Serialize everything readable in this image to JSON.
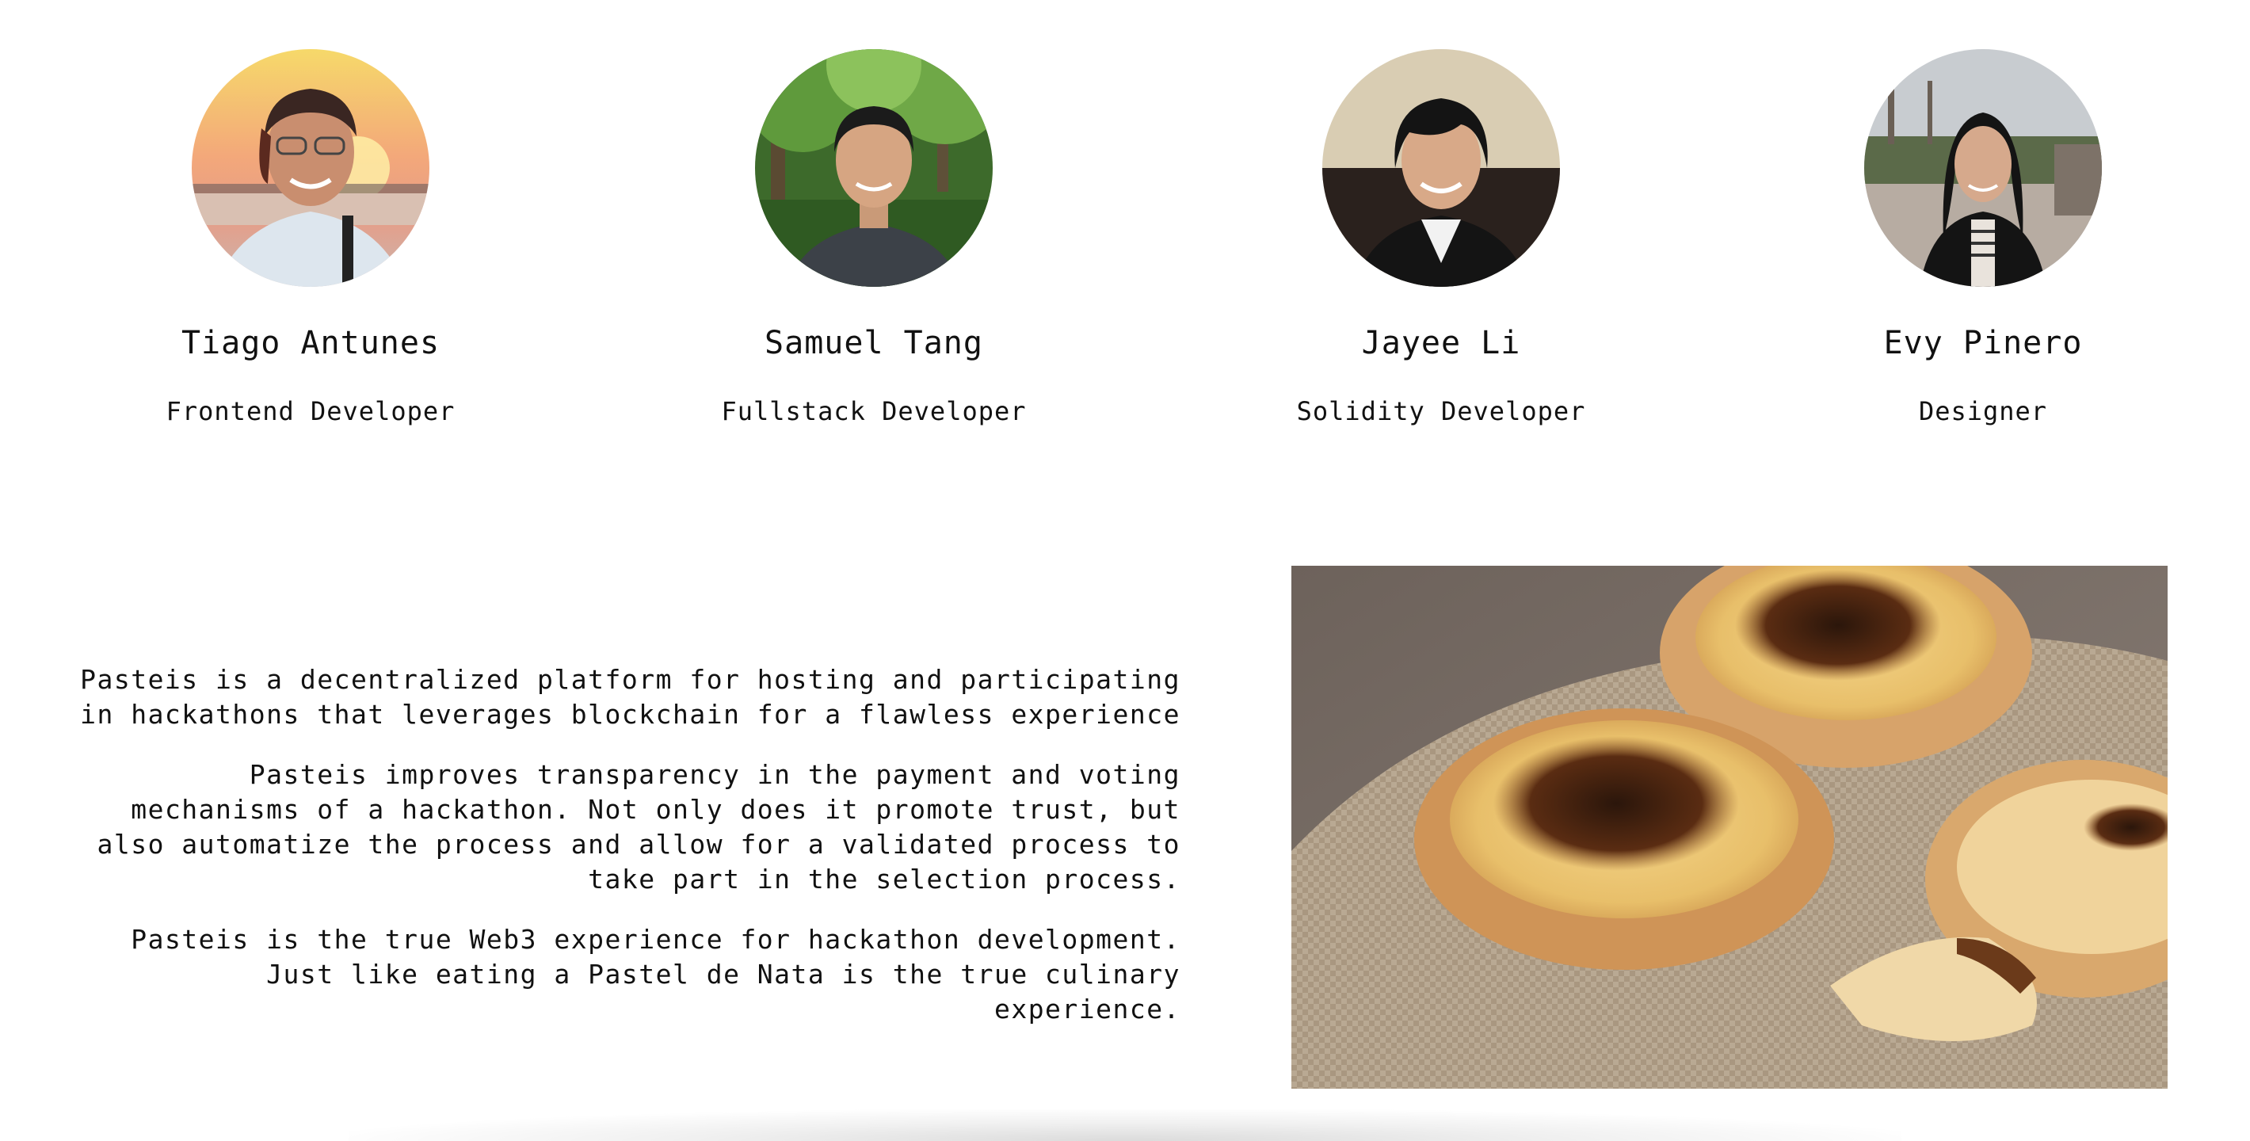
{
  "team": {
    "members": [
      {
        "name": "Tiago Antunes",
        "role": "Frontend Developer",
        "photo_icon": "portrait-sunset-photo"
      },
      {
        "name": "Samuel Tang",
        "role": "Fullstack Developer",
        "photo_icon": "portrait-forest-photo"
      },
      {
        "name": "Jayee Li",
        "role": "Solidity Developer",
        "photo_icon": "portrait-indoor-photo"
      },
      {
        "name": "Evy Pinero",
        "role": "Designer",
        "photo_icon": "portrait-park-photo"
      }
    ]
  },
  "about": {
    "paragraphs": [
      "Pasteis is a decentralized platform for hosting and participating in hackathons that leverages blockchain for a flawless experience",
      "Pasteis improves transparency in the payment and voting mechanisms of a hackathon. Not only does it promote trust, but also automatize the process and allow for a validated process to take part in the selection process.",
      "Pasteis is the true Web3 experience for hackathon development. Just like eating a Pastel de Nata is the true culinary experience."
    ]
  },
  "image": {
    "icon": "pastel-de-nata-photo"
  },
  "colors": {
    "background": "#ffffff",
    "text": "#111111"
  }
}
